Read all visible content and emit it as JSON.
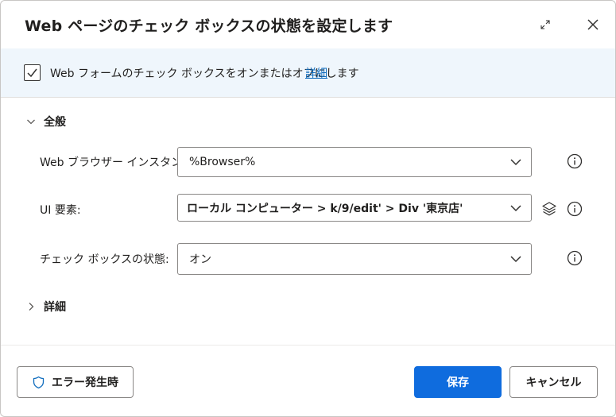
{
  "dialog": {
    "title": "Web ページのチェック ボックスの状態を設定します"
  },
  "banner": {
    "text": "Web フォームのチェック ボックスをオンまたはオフにします",
    "link": "詳細"
  },
  "sections": {
    "general": "全般",
    "advanced": "詳細"
  },
  "fields": {
    "browser": {
      "label": "Web ブラウザー インスタンス:",
      "value": "%Browser%"
    },
    "ui_element": {
      "label": "UI 要素:",
      "value": "ローカル コンピューター > k/9/edit' > Div '東京店'"
    },
    "checkbox_state": {
      "label": "チェック ボックスの状態:",
      "value": "オン"
    }
  },
  "footer": {
    "on_error": "エラー発生時",
    "save": "保存",
    "cancel": "キャンセル"
  },
  "colors": {
    "accent": "#0f6cde",
    "link": "#0f6cbd",
    "banner_bg": "#eff6fc"
  }
}
